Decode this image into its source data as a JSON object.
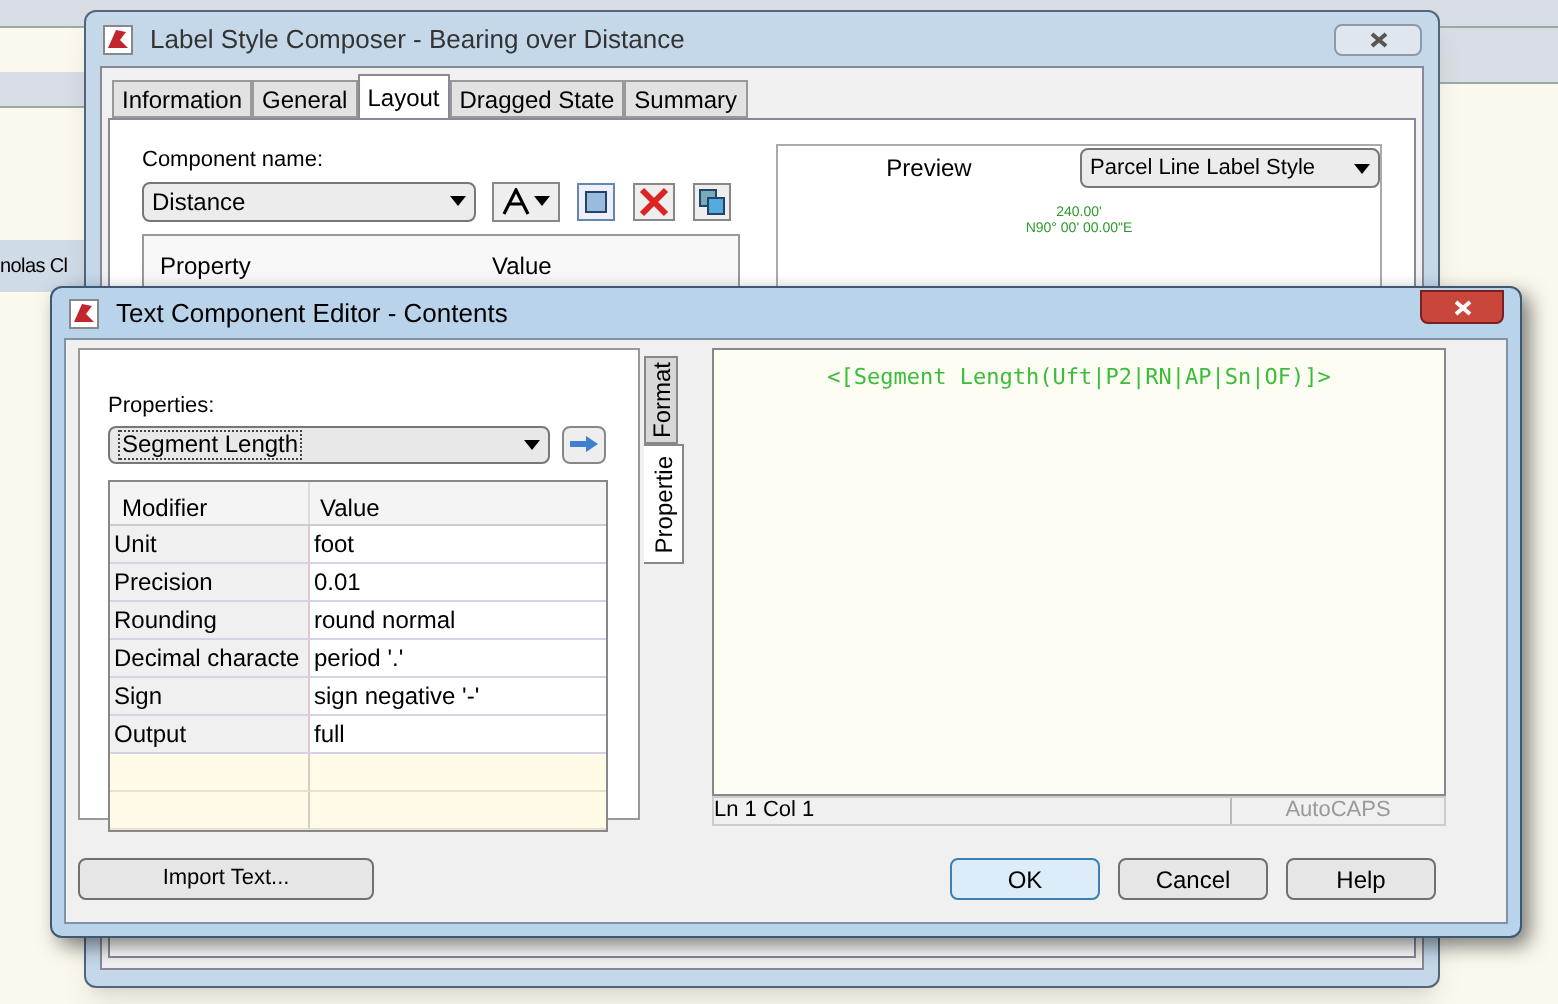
{
  "desktop_label": "nolas Cl",
  "composer": {
    "title": "Label Style Composer - Bearing over Distance",
    "tabs": [
      {
        "label": "Information",
        "selected": false
      },
      {
        "label": "General",
        "selected": false
      },
      {
        "label": "Layout",
        "selected": true
      },
      {
        "label": "Dragged State",
        "selected": false
      },
      {
        "label": "Summary",
        "selected": false
      }
    ],
    "component_name_label": "Component name:",
    "component_name": "Distance",
    "property_columns": [
      "Property",
      "Value"
    ],
    "preview_tab": "Preview",
    "style_select": "Parcel Line Label Style",
    "preview_labels": [
      "240.00'",
      "N90° 00' 00.00\"E"
    ]
  },
  "editor": {
    "title": "Text Component Editor - Contents",
    "properties_label": "Properties:",
    "property_select": "Segment Length",
    "columns": [
      "Modifier",
      "Value"
    ],
    "rows": [
      {
        "modifier": "Unit",
        "value": "foot"
      },
      {
        "modifier": "Precision",
        "value": "0.01"
      },
      {
        "modifier": "Rounding",
        "value": "round normal"
      },
      {
        "modifier": "Decimal characte",
        "value": "period '.'"
      },
      {
        "modifier": "Sign",
        "value": "sign negative '-'"
      },
      {
        "modifier": "Output",
        "value": "full"
      }
    ],
    "side_tabs": [
      {
        "label": "Format",
        "selected": false
      },
      {
        "label": "Propertie",
        "selected": true
      }
    ],
    "content": "<[Segment Length(Uft|P2|RN|AP|Sn|OF)]>",
    "status_position": "Ln 1 Col 1",
    "status_caps": "AutoCAPS",
    "import_button": "Import Text...",
    "buttons": [
      {
        "label": "OK",
        "default": true
      },
      {
        "label": "Cancel",
        "default": false
      },
      {
        "label": "Help",
        "default": false
      }
    ]
  }
}
